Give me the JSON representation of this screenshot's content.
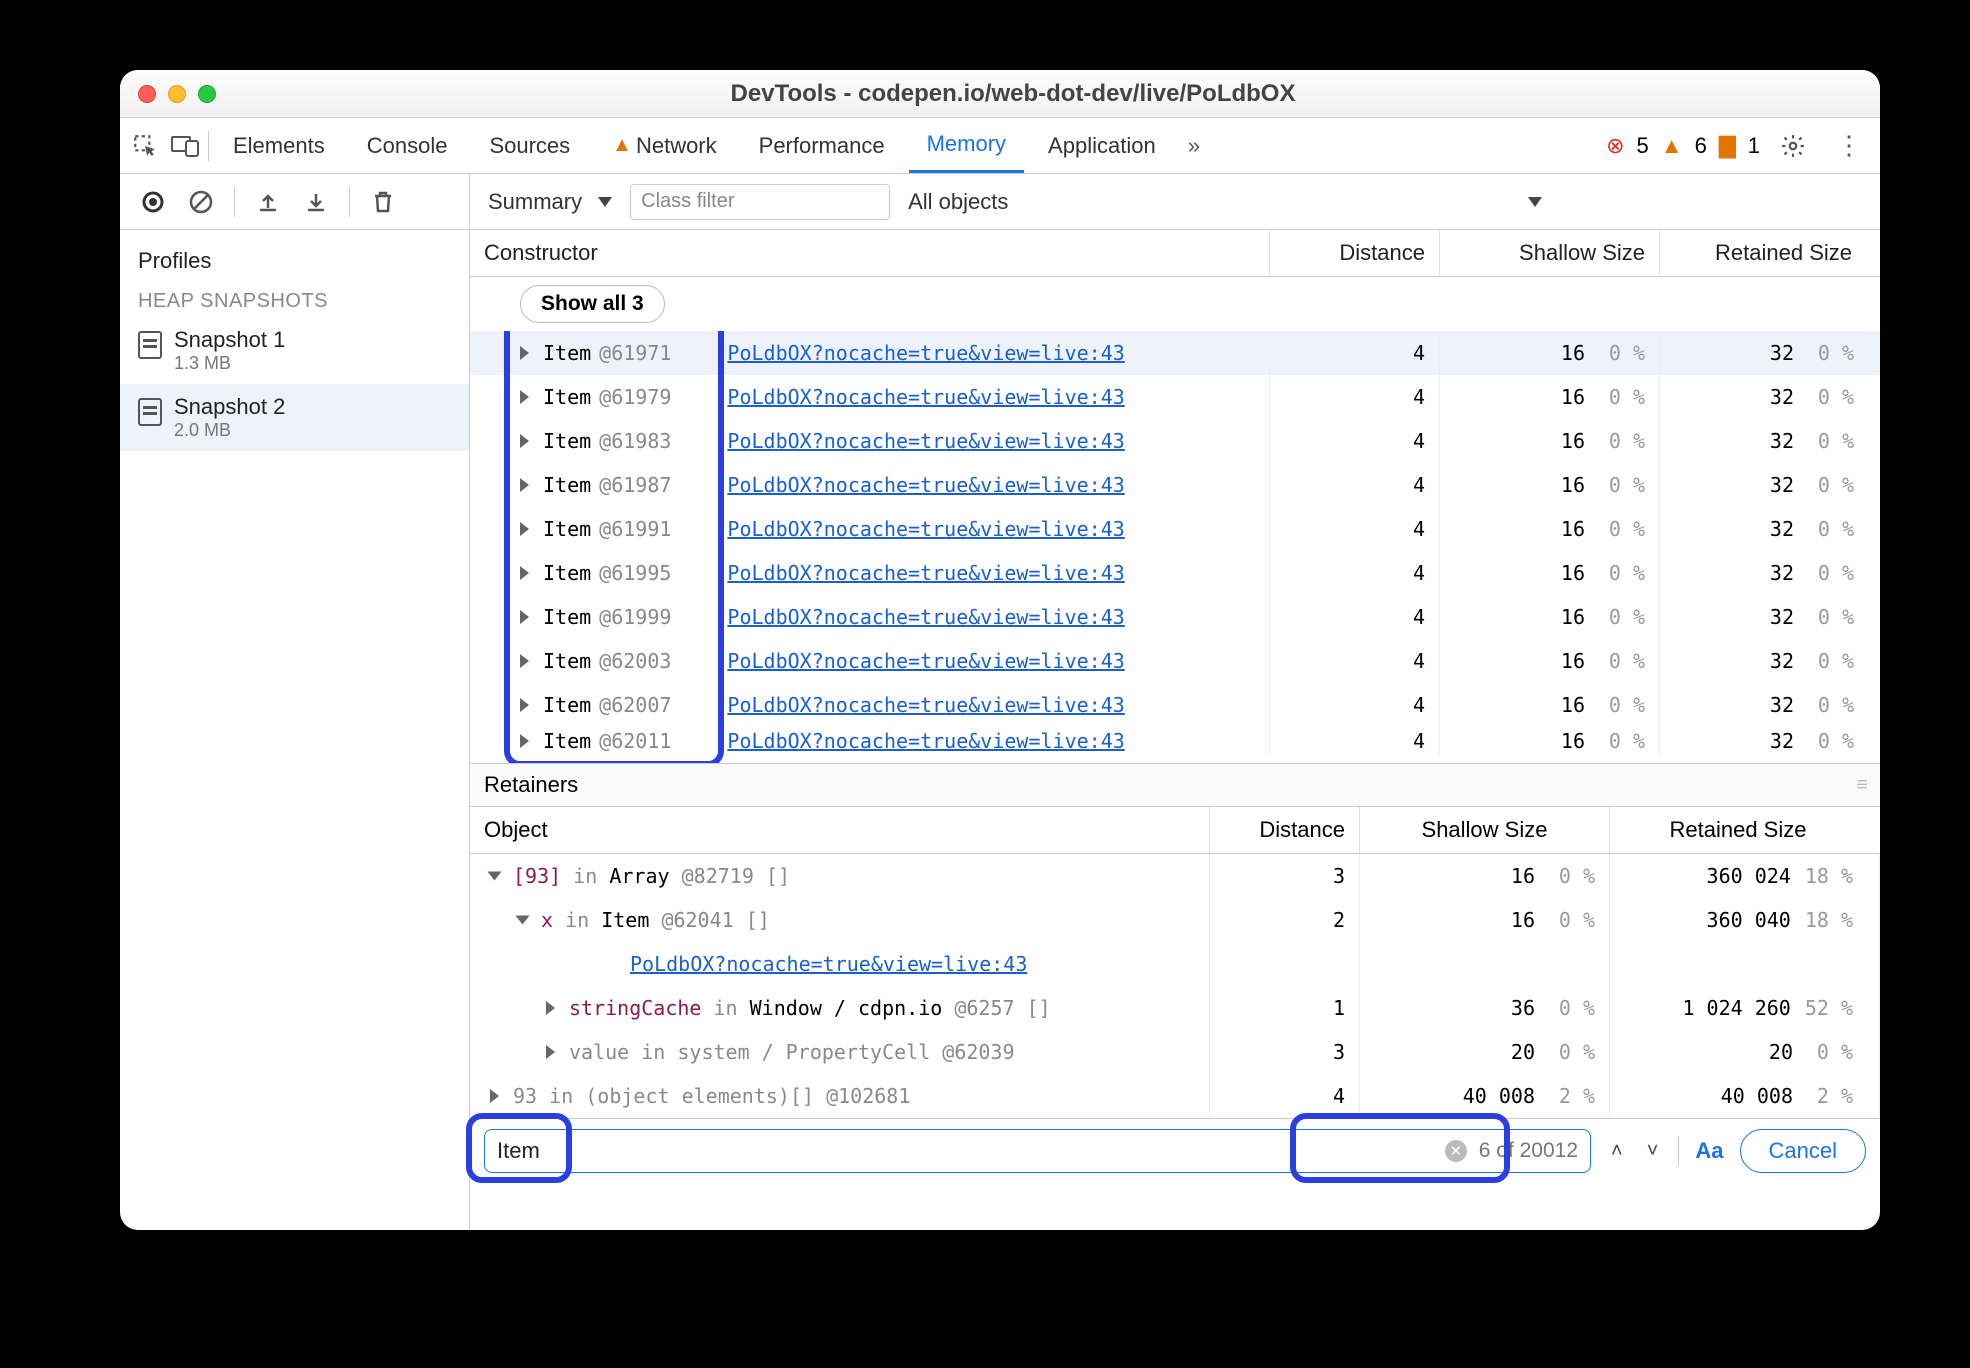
{
  "title": "DevTools - codepen.io/web-dot-dev/live/PoLdbOX",
  "tabs": {
    "elements": "Elements",
    "console": "Console",
    "sources": "Sources",
    "network": "Network",
    "performance": "Performance",
    "memory": "Memory",
    "application": "Application"
  },
  "badges": {
    "errors": "5",
    "warnings": "6",
    "issues": "1"
  },
  "sidebar": {
    "profiles": "Profiles",
    "heading": "HEAP SNAPSHOTS",
    "snapshots": [
      {
        "name": "Snapshot 1",
        "size": "1.3 MB"
      },
      {
        "name": "Snapshot 2",
        "size": "2.0 MB"
      }
    ]
  },
  "toolbar": {
    "summary": "Summary",
    "classFilter": "Class filter",
    "allObjects": "All objects"
  },
  "headers": {
    "constructor": "Constructor",
    "distance": "Distance",
    "shallow": "Shallow Size",
    "retained": "Retained Size"
  },
  "showAll": "Show all 3",
  "link": "PoLdbOX?nocache=true&view=live:43",
  "rows": [
    {
      "name": "Item",
      "id": "@61971",
      "dist": "4",
      "shallow": "16",
      "shallowPct": "0 %",
      "retained": "32",
      "retainedPct": "0 %",
      "sel": true
    },
    {
      "name": "Item",
      "id": "@61979",
      "dist": "4",
      "shallow": "16",
      "shallowPct": "0 %",
      "retained": "32",
      "retainedPct": "0 %"
    },
    {
      "name": "Item",
      "id": "@61983",
      "dist": "4",
      "shallow": "16",
      "shallowPct": "0 %",
      "retained": "32",
      "retainedPct": "0 %"
    },
    {
      "name": "Item",
      "id": "@61987",
      "dist": "4",
      "shallow": "16",
      "shallowPct": "0 %",
      "retained": "32",
      "retainedPct": "0 %"
    },
    {
      "name": "Item",
      "id": "@61991",
      "dist": "4",
      "shallow": "16",
      "shallowPct": "0 %",
      "retained": "32",
      "retainedPct": "0 %"
    },
    {
      "name": "Item",
      "id": "@61995",
      "dist": "4",
      "shallow": "16",
      "shallowPct": "0 %",
      "retained": "32",
      "retainedPct": "0 %"
    },
    {
      "name": "Item",
      "id": "@61999",
      "dist": "4",
      "shallow": "16",
      "shallowPct": "0 %",
      "retained": "32",
      "retainedPct": "0 %"
    },
    {
      "name": "Item",
      "id": "@62003",
      "dist": "4",
      "shallow": "16",
      "shallowPct": "0 %",
      "retained": "32",
      "retainedPct": "0 %"
    },
    {
      "name": "Item",
      "id": "@62007",
      "dist": "4",
      "shallow": "16",
      "shallowPct": "0 %",
      "retained": "32",
      "retainedPct": "0 %"
    },
    {
      "name": "Item",
      "id": "@62011",
      "dist": "4",
      "shallow": "16",
      "shallowPct": "0 %",
      "retained": "32",
      "retainedPct": "0 %",
      "clip": true
    }
  ],
  "retainers": {
    "label": "Retainers",
    "headers": {
      "object": "Object",
      "distance": "Distance",
      "shallow": "Shallow Size",
      "retained": "Retained Size"
    },
    "rows": [
      {
        "indent": 0,
        "open": true,
        "html": "<span class='kw'>[93]</span> <span class='gray'>in</span> Array <span class='id'>@82719</span> <span class='gray'>[]</span>",
        "dist": "3",
        "shallow": "16",
        "spct": "0 %",
        "retained": "360 024",
        "rpct": "18 %"
      },
      {
        "indent": 1,
        "open": true,
        "html": "<span class='kw'>x</span> <span class='gray'>in</span> Item <span class='id'>@62041</span> <span class='gray'>[]</span>",
        "dist": "2",
        "shallow": "16",
        "spct": "0 %",
        "retained": "360 040",
        "rpct": "18 %"
      },
      {
        "indent": 5,
        "linkOnly": true
      },
      {
        "indent": 2,
        "open": false,
        "html": "<span class='kw'>stringCache</span> <span class='gray'>in</span> Window / cdpn.io <span class='id'>@6257</span> <span class='gray'>[]</span>",
        "dist": "1",
        "shallow": "36",
        "spct": "0 %",
        "retained": "1 024 260",
        "rpct": "52 %"
      },
      {
        "indent": 2,
        "open": false,
        "html": "<span class='gray'>value in system / PropertyCell @62039</span>",
        "dist": "3",
        "shallow": "20",
        "spct": "0 %",
        "retained": "20",
        "rpct": "0 %"
      },
      {
        "indent": 0,
        "open": false,
        "html": "<span class='gray'>93 in (object elements)[] @102681</span>",
        "dist": "4",
        "shallow": "40 008",
        "spct": "2 %",
        "retained": "40 008",
        "rpct": "2 %"
      }
    ]
  },
  "search": {
    "value": "Item",
    "count": "6 of 20012",
    "aa": "Aa",
    "cancel": "Cancel"
  }
}
